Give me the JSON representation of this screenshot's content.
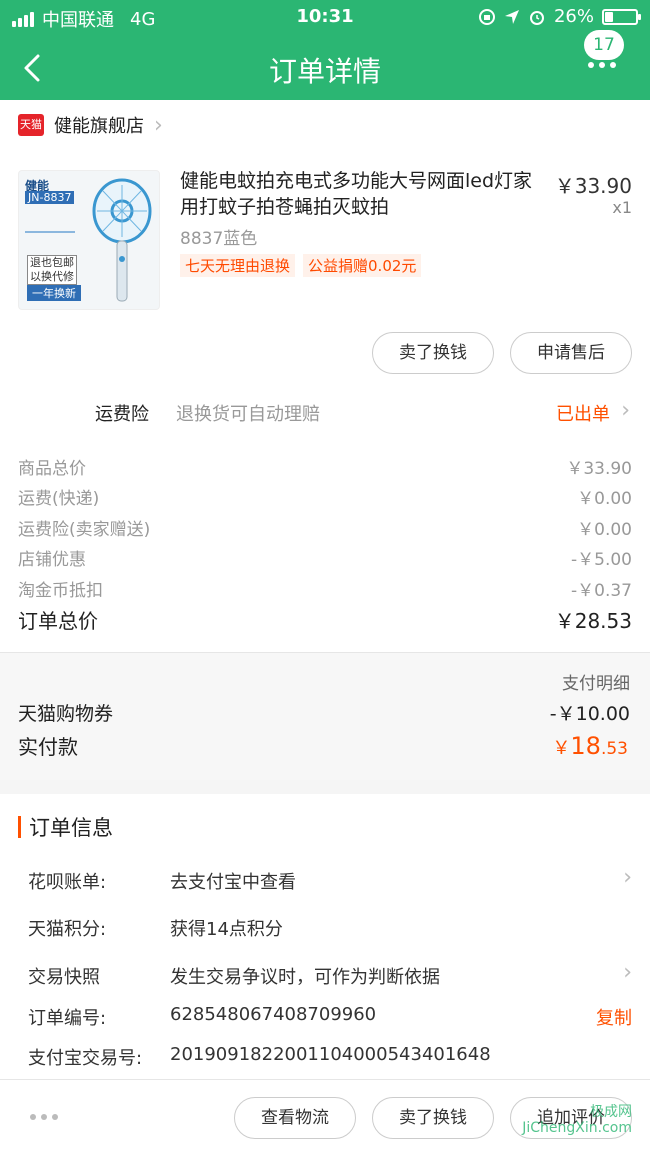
{
  "status_bar": {
    "carrier": "中国联通",
    "network": "4G",
    "time": "10:31",
    "battery": "26%",
    "battery_level": 0.26
  },
  "nav": {
    "title": "订单详情",
    "badge_count": "17",
    "back_icon": "chevron-left-icon",
    "more_icon": "more-dots-icon"
  },
  "shop": {
    "platform_logo": "天猫",
    "name": "健能旗舰店"
  },
  "product": {
    "thumb_brand": "健能",
    "thumb_model": "JN-8837",
    "thumb_stamp1": "退也包邮 以换代修",
    "thumb_stamp2": "一年换新",
    "title": "健能电蚊拍充电式多功能大号网面led灯家用打蚊子拍苍蝇拍灭蚊拍",
    "price": "￥33.90",
    "qty": "x1",
    "sku": "8837蓝色",
    "tags": [
      "七天无理由退换",
      "公益捐赠0.02元"
    ]
  },
  "actions": {
    "sell": "卖了换钱",
    "after_sale": "申请售后"
  },
  "insurance": {
    "label": "运费险",
    "desc": "退换货可自动理赔",
    "status": "已出单"
  },
  "fees": [
    {
      "label": "商品总价",
      "value": "￥33.90"
    },
    {
      "label": "运费(快递)",
      "value": "￥0.00"
    },
    {
      "label": "运费险(卖家赠送)",
      "value": "￥0.00"
    },
    {
      "label": "店铺优惠",
      "value": "-￥5.00"
    },
    {
      "label": "淘金币抵扣",
      "value": "-￥0.37"
    }
  ],
  "total": {
    "label": "订单总价",
    "value": "￥28.53"
  },
  "payment": {
    "detail_label": "支付明细",
    "voucher_label": "天猫购物券",
    "voucher_value": "-￥10.00",
    "actual_label": "实付款",
    "actual_currency": "￥",
    "actual_int": "18",
    "actual_dec": ".53"
  },
  "order_info": {
    "title": "订单信息",
    "rows": [
      {
        "key": "花呗账单:",
        "value": "去支付宝中查看"
      },
      {
        "key": "天猫积分:",
        "value": "获得14点积分"
      },
      {
        "key": "交易快照",
        "value": "发生交易争议时，可作为判断依据"
      },
      {
        "key": "订单编号:",
        "value": "628548067408709960",
        "action": "复制"
      },
      {
        "key": "支付宝交易号:",
        "value": "2019091822001104000543401648"
      }
    ]
  },
  "bottom_bar": {
    "logistics": "查看物流",
    "sell": "卖了换钱",
    "review": "追加评价"
  },
  "watermark": {
    "line1": "极成网",
    "line2": "JiChengXin.com"
  },
  "colors": {
    "header": "#2bb673",
    "accent": "#ff5000",
    "tmall_red": "#e5242a"
  }
}
